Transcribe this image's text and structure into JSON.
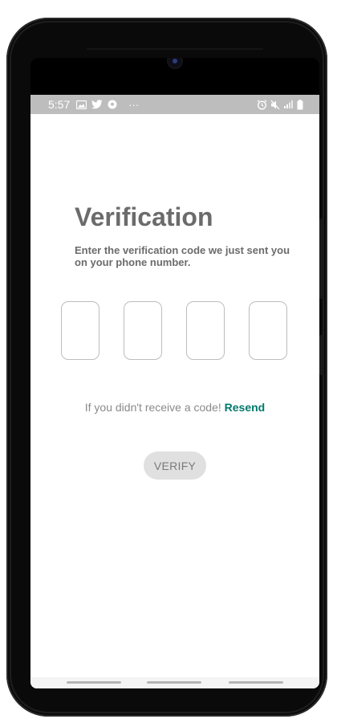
{
  "status_bar": {
    "time": "5:57",
    "left_icons": [
      "image-icon",
      "twitter-icon",
      "soccer-ball-icon",
      "more-dots-icon"
    ],
    "more_dots": "···",
    "right_icons": [
      "alarm-icon",
      "mute-icon",
      "signal-icon",
      "battery-icon"
    ]
  },
  "screen": {
    "title": "Verification",
    "subtitle": "Enter the verification code we just sent you on your phone number.",
    "otp_fields": [
      {
        "value": ""
      },
      {
        "value": ""
      },
      {
        "value": ""
      },
      {
        "value": ""
      }
    ],
    "resend_prompt": "If you didn't receive a code!",
    "resend_link": "Resend",
    "verify_label": "VERIFY"
  },
  "colors": {
    "title_text": "#6b6b6b",
    "link": "#00796b",
    "button_bg": "#e0e0e0",
    "status_bar_bg": "#bdbdbd"
  }
}
